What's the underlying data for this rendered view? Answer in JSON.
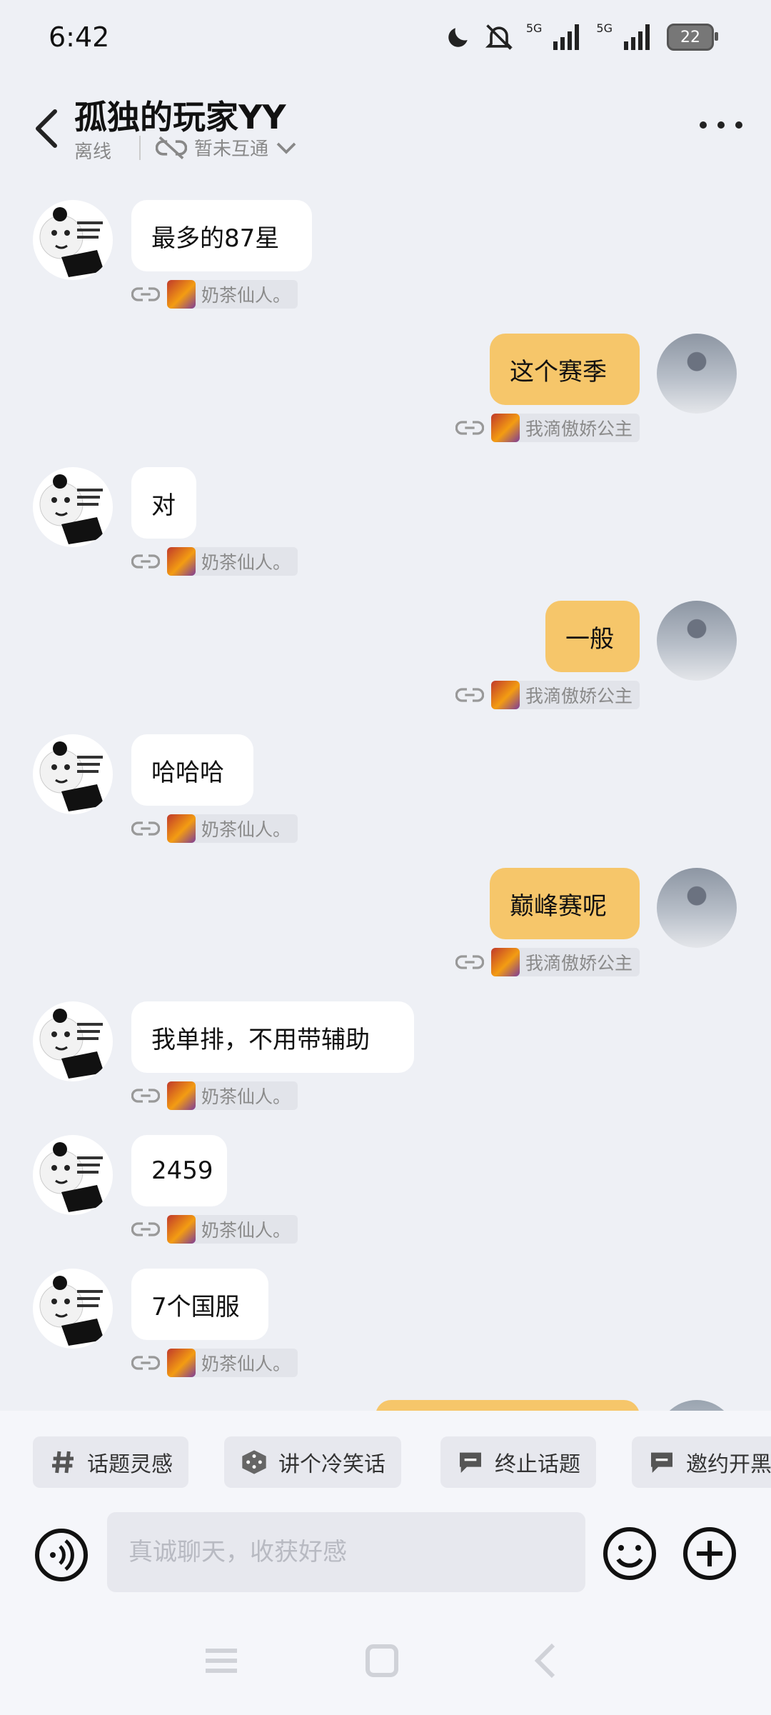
{
  "status_bar": {
    "time": "6:42",
    "battery": "22",
    "net1": "5G",
    "net2": "5G"
  },
  "header": {
    "title": "孤独的玩家YY",
    "presence": "离线",
    "link_status": "暂未互通"
  },
  "messages": [
    {
      "dir": "in",
      "text": "最多的87星",
      "tag": "奶茶仙人。"
    },
    {
      "dir": "out",
      "text": "这个赛季",
      "tag": "我滴傲娇公主"
    },
    {
      "dir": "in",
      "text": "对",
      "tag": "奶茶仙人。"
    },
    {
      "dir": "out",
      "text": "一般",
      "tag": "我滴傲娇公主"
    },
    {
      "dir": "in",
      "text": "哈哈哈",
      "tag": "奶茶仙人。"
    },
    {
      "dir": "out",
      "text": "巅峰赛呢",
      "tag": "我滴傲娇公主"
    },
    {
      "dir": "in",
      "text": "我单排，不用带辅助",
      "tag": "奶茶仙人。"
    },
    {
      "dir": "in",
      "text": "2459",
      "tag": "奶茶仙人。"
    },
    {
      "dir": "in",
      "text": "7个国服",
      "tag": "奶茶仙人。"
    }
  ],
  "suggestions": [
    "话题灵感",
    "讲个冷笑话",
    "终止话题",
    "邀约开黑"
  ],
  "input": {
    "placeholder": "真诚聊天，收获好感"
  },
  "colors": {
    "bubble_out": "#f6c66a",
    "bubble_in": "#ffffff",
    "background": "#eef0f5"
  },
  "icons": [
    "back-arrow-icon",
    "unlink-icon",
    "chevron-down-icon",
    "more-icon",
    "link-icon",
    "hash-icon",
    "dice-icon",
    "chat-icon",
    "voice-icon",
    "emoji-icon",
    "plus-icon"
  ]
}
